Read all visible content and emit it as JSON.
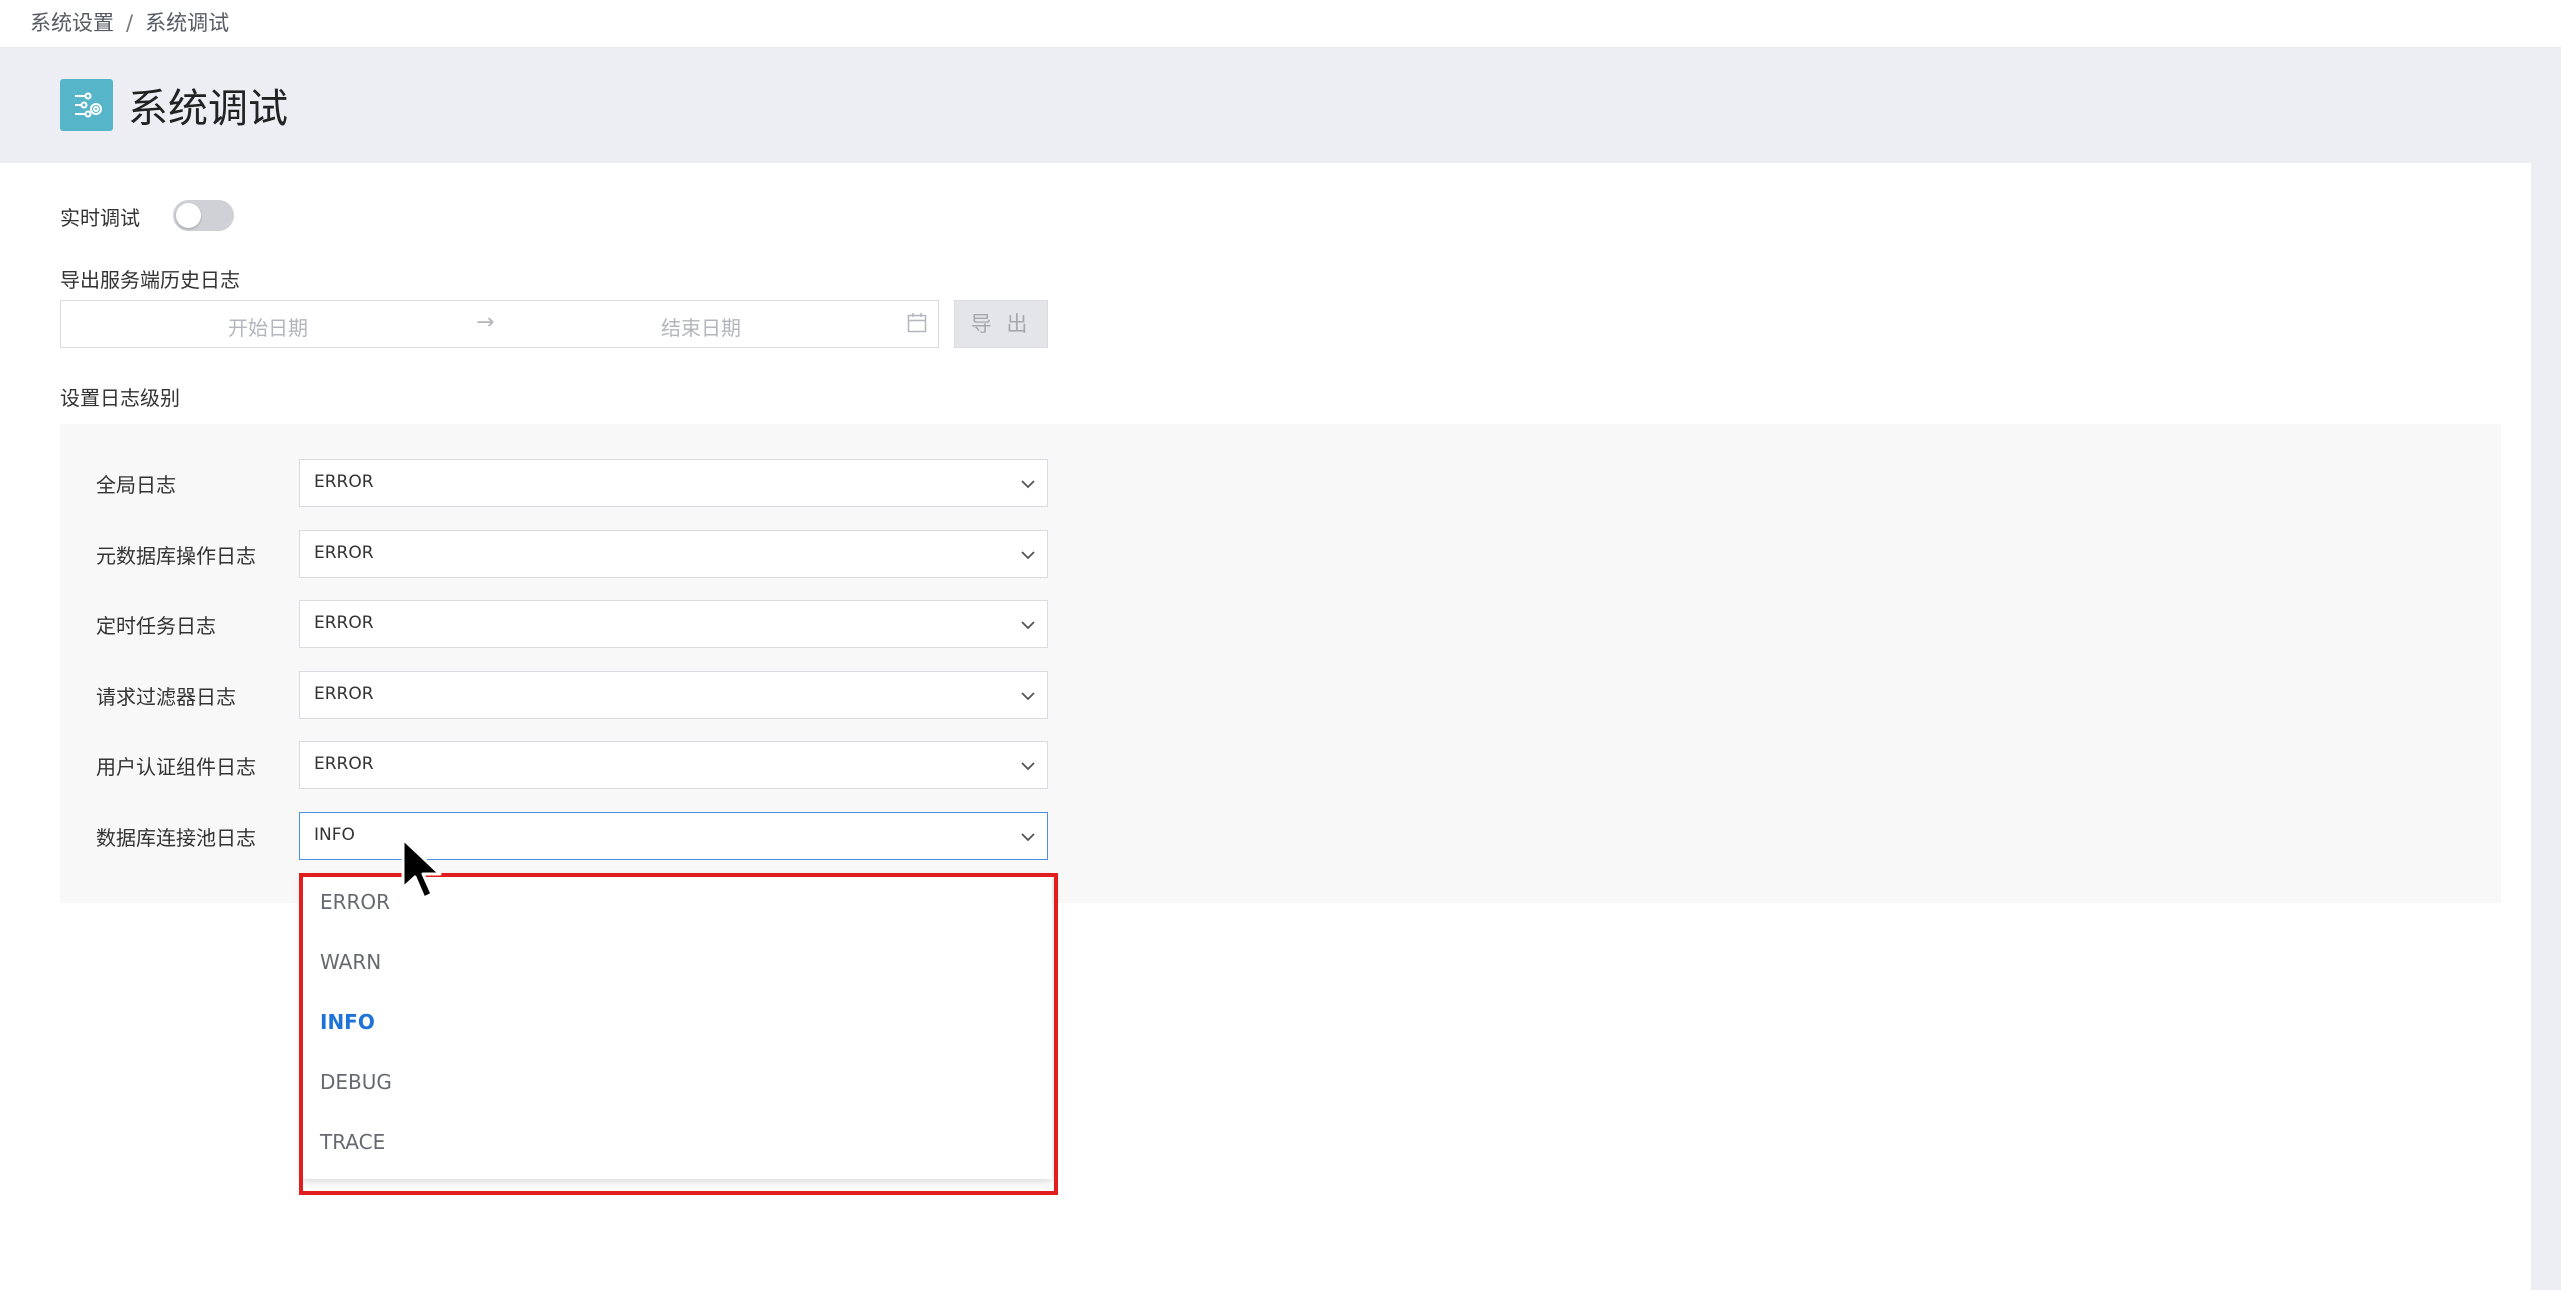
{
  "breadcrumb": {
    "parent": "系统设置",
    "separator": "/",
    "current": "系统调试"
  },
  "page": {
    "title": "系统调试",
    "icon": "debug-settings-icon"
  },
  "realtime_debug": {
    "label": "实时调试",
    "enabled": false
  },
  "export_logs": {
    "label": "导出服务端历史日志",
    "start_placeholder": "开始日期",
    "end_placeholder": "结束日期",
    "range_arrow": "→",
    "button_label": "导 出",
    "button_disabled": true
  },
  "log_levels": {
    "section_label": "设置日志级别",
    "rows": [
      {
        "label": "全局日志",
        "value": "ERROR"
      },
      {
        "label": "元数据库操作日志",
        "value": "ERROR"
      },
      {
        "label": "定时任务日志",
        "value": "ERROR"
      },
      {
        "label": "请求过滤器日志",
        "value": "ERROR"
      },
      {
        "label": "用户认证组件日志",
        "value": "ERROR"
      },
      {
        "label": "数据库连接池日志",
        "value": "INFO"
      }
    ]
  },
  "dropdown": {
    "open_for": "数据库连接池日志",
    "options": [
      "ERROR",
      "WARN",
      "INFO",
      "DEBUG",
      "TRACE"
    ],
    "selected": "INFO"
  },
  "colors": {
    "accent_blue": "#1f72d8",
    "icon_teal": "#56b5c8",
    "highlight_red": "#e11d1d"
  }
}
